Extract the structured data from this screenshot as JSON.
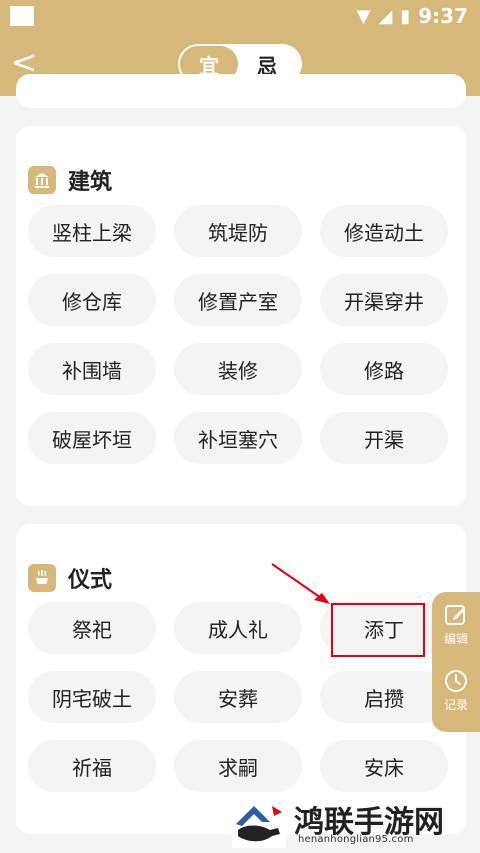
{
  "status": {
    "time": "9:37"
  },
  "header": {
    "back_label": "<",
    "segments": [
      {
        "label": "宜"
      },
      {
        "label": "忌"
      }
    ]
  },
  "sections": {
    "building": {
      "title": "建筑",
      "items": [
        "竖柱上梁",
        "筑堤防",
        "修造动土",
        "修仓库",
        "修置产室",
        "开渠穿井",
        "补围墙",
        "装修",
        "修路",
        "破屋坏垣",
        "补垣塞穴",
        "开渠"
      ]
    },
    "ritual": {
      "title": "仪式",
      "items": [
        "祭祀",
        "成人礼",
        "添丁",
        "阴宅破土",
        "安葬",
        "启攒",
        "祈福",
        "求嗣",
        "安床"
      ]
    }
  },
  "side_actions": {
    "edit_label": "编辑",
    "record_label": "记录"
  },
  "watermark": {
    "title": "鸿联手游网",
    "url": "henanhonglian95.com"
  },
  "colors": {
    "accent": "#d7b87b",
    "highlight": "#e60012"
  }
}
